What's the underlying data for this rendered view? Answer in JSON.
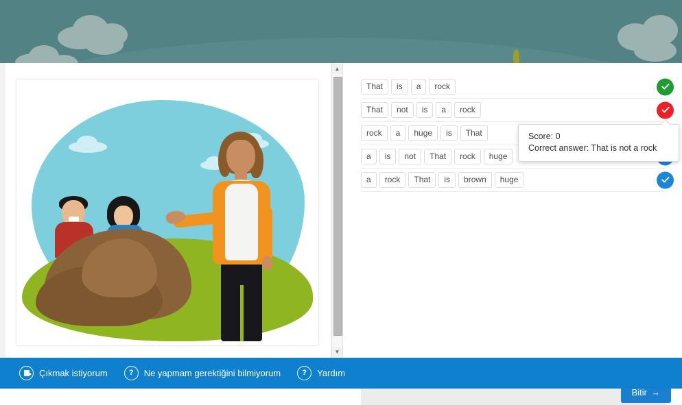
{
  "header": {
    "sky_color": "#538285",
    "cloud_color": "#a9bcba"
  },
  "illustration": {
    "alt": "Woman gesturing toward a huge brown rock with a man and a girl behind it",
    "sky_color": "#7ecfdd",
    "grass_color": "#8fb520",
    "rock_color": "#8a6239"
  },
  "scrollbar": {
    "up_arrow": "▲",
    "down_arrow": "▼"
  },
  "answers": {
    "rows": [
      {
        "words": [
          "That",
          "is",
          "a",
          "rock"
        ],
        "status": "correct",
        "status_color": "#1f9d32"
      },
      {
        "words": [
          "That",
          "not",
          "is",
          "a",
          "rock"
        ],
        "status": "incorrect",
        "status_color": "#ec2027"
      },
      {
        "words": [
          "rock",
          "a",
          "huge",
          "is",
          "That"
        ],
        "status": "submitted",
        "status_color": "#1b85d6"
      },
      {
        "words": [
          "a",
          "is",
          "not",
          "That",
          "rock",
          "huge"
        ],
        "status": "submitted",
        "status_color": "#1b85d6"
      },
      {
        "words": [
          "a",
          "rock",
          "That",
          "is",
          "brown",
          "huge"
        ],
        "status": "submitted",
        "status_color": "#1b85d6"
      }
    ]
  },
  "tooltip": {
    "score_line": "Score: 0",
    "answer_line": "Correct answer: That is not a rock"
  },
  "action_bar": {
    "finish_label": "Bitir",
    "finish_arrow": "→",
    "button_color": "#1b7fd0"
  },
  "bottom_bar": {
    "background": "#0e80cd",
    "items": [
      {
        "icon": "exit-icon",
        "label": "Çıkmak istiyorum",
        "glyph": ""
      },
      {
        "icon": "question-mark-icon",
        "label": "Ne yapmam gerektiğini bilmiyorum",
        "glyph": "?"
      },
      {
        "icon": "question-mark-icon",
        "label": "Yardım",
        "glyph": "?"
      }
    ]
  }
}
